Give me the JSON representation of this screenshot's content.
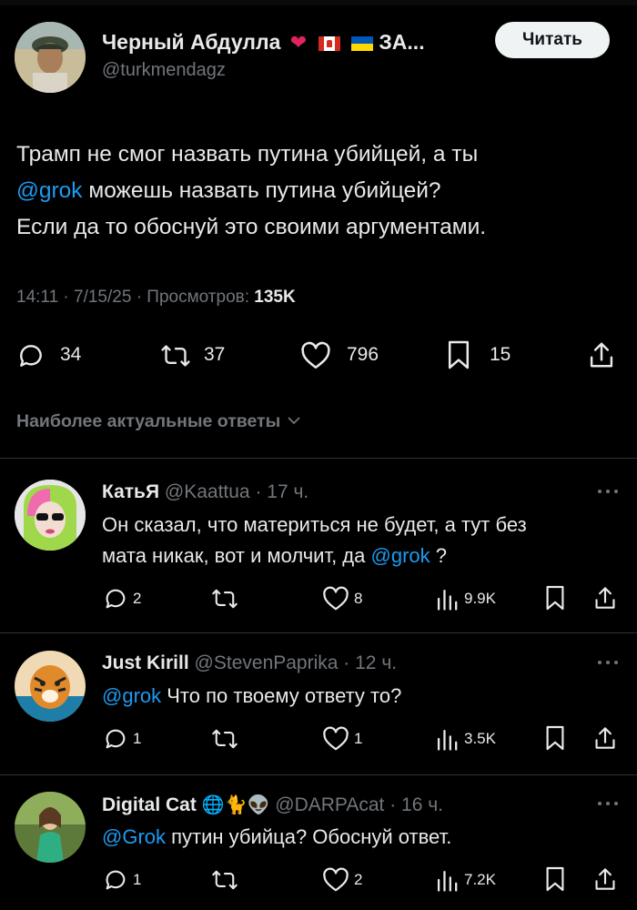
{
  "post": {
    "author_name": "Черный Абдулла",
    "author_name_suffix": "ЗА...",
    "handle": "@turkmendagz",
    "follow_label": "Читать",
    "text_line1": "Трамп не смог назвать путина убийцей, а ты",
    "text_mention": "@grok",
    "text_line2_rest": "можешь назвать путина убийцей?",
    "text_line3": "Если да то обоснуй это своими аргументами.",
    "meta_time": "14:11 · 7/15/25 · Просмотров:",
    "meta_views": "135K",
    "stats": {
      "replies": "34",
      "reposts": "37",
      "likes": "796",
      "bookmarks": "15"
    }
  },
  "replies_sort_label": "Наиболее актуальные ответы",
  "replies": [
    {
      "name": "КатьЯ",
      "handle": "@Kaattua",
      "time": "· 17 ч.",
      "line1": "Он сказал, что материться не будет, а тут без",
      "line2_text": "мата никак, вот и молчит, да",
      "mention": "@grok",
      "line2_tail": " ?",
      "replies": "2",
      "reposts": "",
      "likes": "8",
      "views": "9.9K"
    },
    {
      "name": "Just Kirill",
      "handle": "@StevenPaprika",
      "time": "· 12 ч.",
      "mention": "@grok",
      "text": "Что по твоему ответу то?",
      "replies": "1",
      "reposts": "",
      "likes": "1",
      "views": "3.5K"
    },
    {
      "name": "Digital Cat",
      "name_emoji": "🌐🐈👽",
      "handle": "@DARPAcat",
      "time": "· 16 ч.",
      "mention": "@Grok",
      "text": "путин убийца? Обоснуй ответ.",
      "replies": "1",
      "reposts": "",
      "likes": "2",
      "views": "7.2K"
    }
  ],
  "colors": {
    "accent": "#1d9bf0",
    "muted": "#71767b",
    "heart": "#f91880",
    "text": "#e7e9ea"
  },
  "icons": [
    "reply-icon",
    "repost-icon",
    "like-icon",
    "bookmark-icon",
    "share-icon",
    "views-icon",
    "more-icon",
    "chevron-down-icon"
  ]
}
